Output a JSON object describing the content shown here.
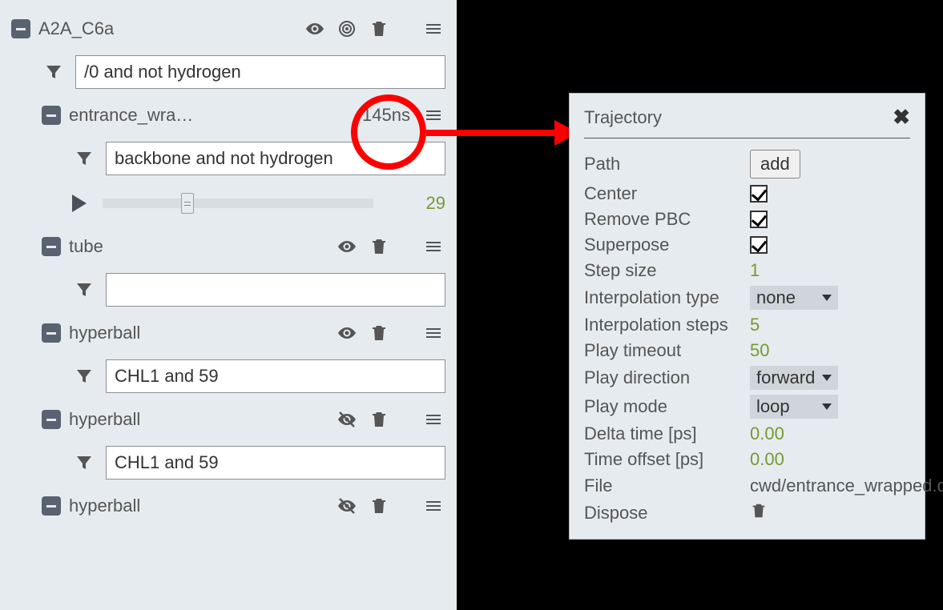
{
  "left": {
    "root": {
      "name": "A2A_C6a",
      "filter": "/0 and not hydrogen"
    },
    "traj": {
      "name": "entrance_wra…",
      "time": "145ns",
      "filter": "backbone and not hydrogen",
      "frame": "29",
      "thumb_pct": 29
    },
    "reps": [
      {
        "name": "tube",
        "visible": true,
        "filter": ""
      },
      {
        "name": "hyperball",
        "visible": true,
        "filter": "CHL1 and 59"
      },
      {
        "name": "hyperball",
        "visible": false,
        "filter": "CHL1 and 59"
      },
      {
        "name": "hyperball",
        "visible": false,
        "filter": ""
      }
    ]
  },
  "popup": {
    "title": "Trajectory",
    "path_btn": "add",
    "center_label": "Center",
    "removepbc_label": "Remove PBC",
    "superpose_label": "Superpose",
    "stepsize_label": "Step size",
    "stepsize_val": "1",
    "interp_type_label": "Interpolation type",
    "interp_type_val": "none",
    "interp_steps_label": "Interpolation steps",
    "interp_steps_val": "5",
    "play_timeout_label": "Play timeout",
    "play_timeout_val": "50",
    "play_dir_label": "Play direction",
    "play_dir_val": "forward",
    "play_mode_label": "Play mode",
    "play_mode_val": "loop",
    "delta_label": "Delta time [ps]",
    "delta_val": "0.00",
    "offset_label": "Time offset [ps]",
    "offset_val": "0.00",
    "file_label": "File",
    "file_val": "cwd/entrance_wrapped.dcd",
    "dispose_label": "Dispose",
    "path_label": "Path"
  }
}
